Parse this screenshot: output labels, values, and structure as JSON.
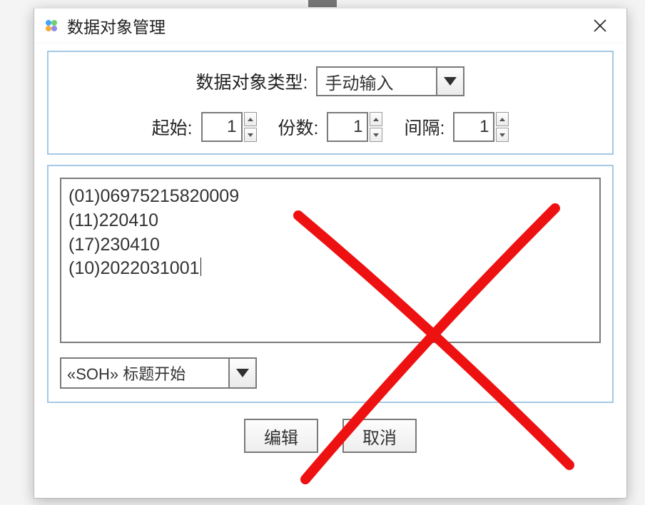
{
  "window": {
    "title": "数据对象管理"
  },
  "header": {
    "type_label": "数据对象类型:",
    "type_value": "手动输入",
    "start_label": "起始:",
    "start_value": "1",
    "copies_label": "份数:",
    "copies_value": "1",
    "interval_label": "间隔:",
    "interval_value": "1"
  },
  "body": {
    "textarea_lines": [
      "(01)06975215820009",
      "(11)220410",
      "(17)230410",
      "(10)2022031001"
    ],
    "soh_value": "«SOH» 标题开始"
  },
  "footer": {
    "edit": "编辑",
    "cancel": "取消"
  },
  "annotation": {
    "mark": "red-x"
  }
}
